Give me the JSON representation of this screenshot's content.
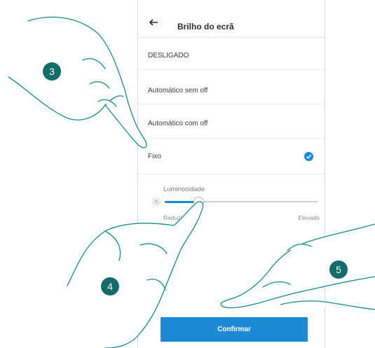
{
  "header": {
    "title": "Brilho do ecrã",
    "back_icon": "arrow-left-icon"
  },
  "options": [
    {
      "label": "DESLIGADO",
      "selected": false
    },
    {
      "label": "Automático sem off",
      "selected": false
    },
    {
      "label": "Automático com off",
      "selected": false
    },
    {
      "label": "Fixo",
      "selected": true
    }
  ],
  "brightness": {
    "label": "Luminosidade",
    "min_label": "Reduzido",
    "max_label": "Elevado",
    "level": 0.22,
    "icon": "sun-icon"
  },
  "confirm_label": "Confirmar",
  "steps": [
    "3",
    "4",
    "5"
  ],
  "colors": {
    "accent": "#1d8ad6",
    "badge": "#146b6b",
    "hand_outline": "#1a8b8b"
  }
}
